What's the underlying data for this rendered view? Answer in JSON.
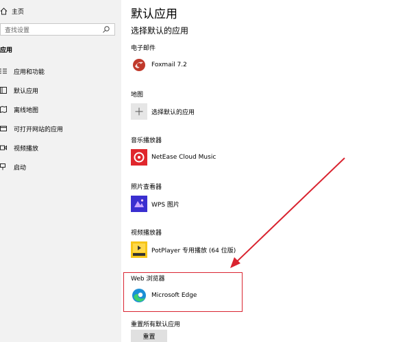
{
  "sidebar": {
    "home_label": "主页",
    "search_placeholder": "查找设置",
    "section_label": "应用",
    "items": [
      {
        "label": "应用和功能",
        "icon": "apps-features-icon"
      },
      {
        "label": "默认应用",
        "icon": "default-apps-icon"
      },
      {
        "label": "离线地图",
        "icon": "offline-maps-icon"
      },
      {
        "label": "可打开网站的应用",
        "icon": "apps-for-websites-icon"
      },
      {
        "label": "视频播放",
        "icon": "video-playback-icon"
      },
      {
        "label": "启动",
        "icon": "startup-icon"
      }
    ]
  },
  "main": {
    "title": "默认应用",
    "subtitle": "选择默认的应用",
    "categories": [
      {
        "label": "电子邮件",
        "app": "Foxmail 7.2"
      },
      {
        "label": "地图",
        "app": "选择默认的应用"
      },
      {
        "label": "音乐播放器",
        "app": "NetEase Cloud Music"
      },
      {
        "label": "照片查看器",
        "app": "WPS 图片"
      },
      {
        "label": "视频播放器",
        "app": "PotPlayer 专用播放 (64 位版)"
      },
      {
        "label": "Web 浏览器",
        "app": "Microsoft Edge"
      }
    ],
    "reset_label": "重置所有默认应用",
    "reset_button": "重置"
  },
  "colors": {
    "sidebar_bg": "#f2f2f2",
    "highlight": "#d9232f",
    "foxmail": "#c0392b",
    "netease": "#e0262c",
    "wps": "#4b3de0",
    "potplayer": "#f5c518",
    "edge": "#1b8fd6"
  }
}
